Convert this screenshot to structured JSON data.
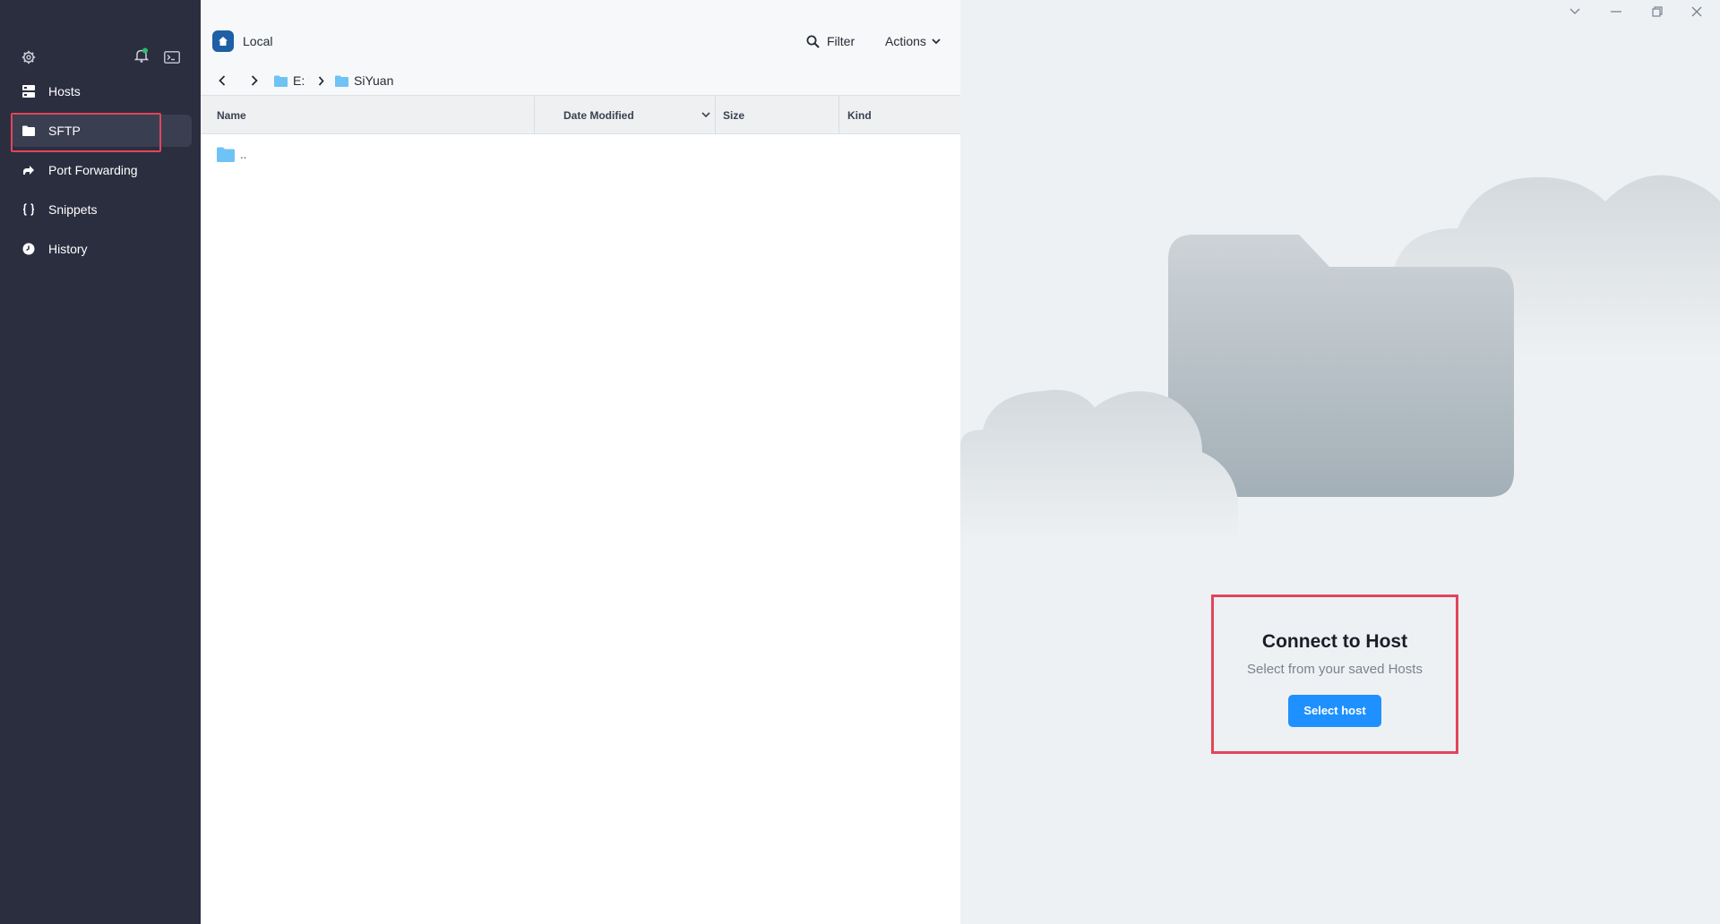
{
  "sidebar": {
    "items": [
      {
        "label": "Hosts",
        "icon": "hosts-icon"
      },
      {
        "label": "SFTP",
        "icon": "folder-icon",
        "active": true
      },
      {
        "label": "Port Forwarding",
        "icon": "port-forward-icon"
      },
      {
        "label": "Snippets",
        "icon": "braces-icon"
      },
      {
        "label": "History",
        "icon": "clock-icon"
      }
    ],
    "top_icons": [
      "settings-gear-icon",
      "notification-bell-icon",
      "terminal-icon"
    ]
  },
  "local": {
    "title": "Local",
    "filter_label": "Filter",
    "actions_label": "Actions",
    "breadcrumb": [
      "E:",
      "SiYuan"
    ],
    "columns": [
      "Name",
      "Date Modified",
      "Size",
      "Kind"
    ],
    "rows": [
      {
        "name": ".."
      }
    ]
  },
  "remote": {
    "connect_title": "Connect to Host",
    "connect_subtitle": "Select from your saved Hosts",
    "select_button": "Select host"
  },
  "colors": {
    "sidebar_bg": "#2b2e3f",
    "accent_blue": "#1e90ff",
    "highlight_red": "#e2455a",
    "folder_blue": "#6ec3f4"
  }
}
